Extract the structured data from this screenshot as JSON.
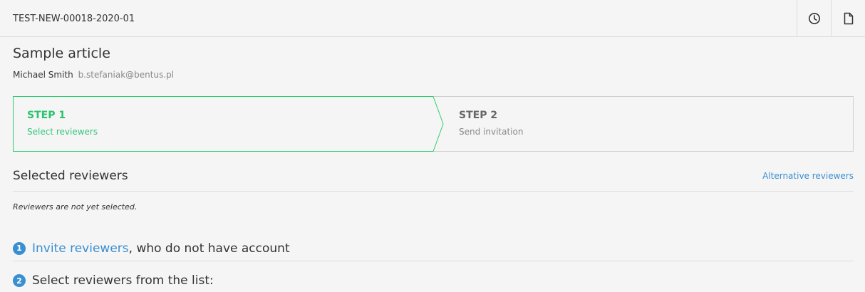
{
  "header": {
    "doc_id": "TEST-NEW-00018-2020-01",
    "actions": [
      {
        "icon": "clock-icon"
      },
      {
        "icon": "document-icon"
      }
    ]
  },
  "article": {
    "title": "Sample article",
    "author_name": "Michael Smith",
    "author_email": "b.stefaniak@bentus.pl"
  },
  "steps": [
    {
      "title": "STEP 1",
      "subtitle": "Select reviewers",
      "state": "active"
    },
    {
      "title": "STEP 2",
      "subtitle": "Send invitation",
      "state": "inactive"
    }
  ],
  "selected_reviewers": {
    "title": "Selected reviewers",
    "alt_link": "Alternative reviewers",
    "empty_note": "Reviewers are not yet selected."
  },
  "instructions": [
    {
      "number": "1",
      "link": "Invite reviewers",
      "text": ", who do not have account"
    },
    {
      "number": "2",
      "text": "Select reviewers from the list:"
    }
  ],
  "colors": {
    "active_step": "#2ecc71",
    "link": "#3a8fd1",
    "border": "#dcdcdc"
  }
}
